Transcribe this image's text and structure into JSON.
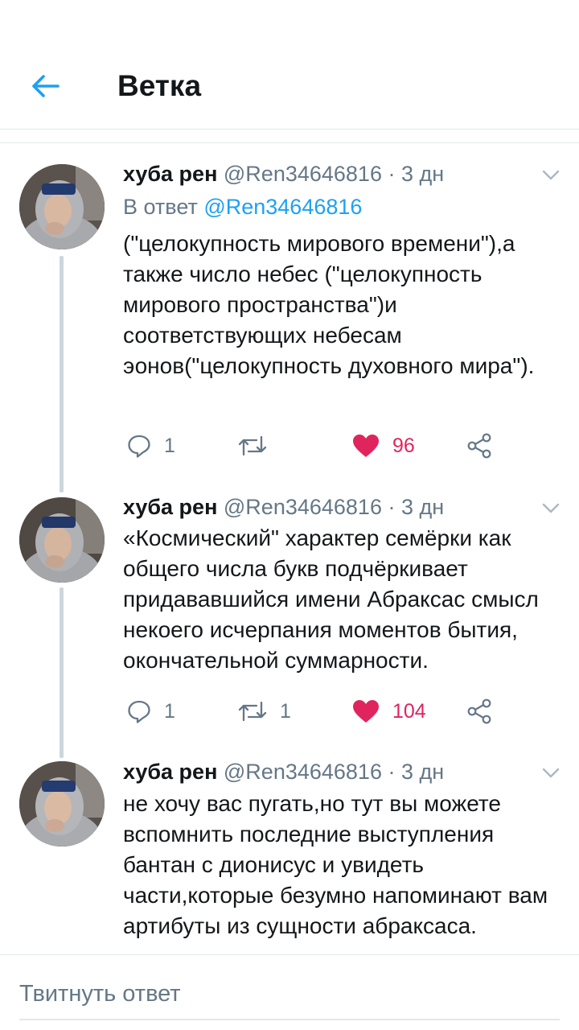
{
  "header": {
    "title": "Ветка",
    "back_icon": "arrow-left-icon",
    "accent_color": "#1da1f2"
  },
  "tweets": [
    {
      "author_name": "хуба рен",
      "handle": "@Ren34646816",
      "time": " · 3 дн",
      "reply_prefix": "В ответ ",
      "reply_mention": "@Ren34646816",
      "text": "(\"целокупность мирового времени\"),а также число небес (\"целокупность мирового пространства\")и соответствующих небесам эонов(\"целокупность духовного мира\").",
      "reply_count": "1",
      "retweet_count": "",
      "like_count": "96"
    },
    {
      "author_name": "хуба рен",
      "handle": "@Ren34646816",
      "time": " · 3 дн",
      "text": "«Космический\" характер семёрки как общего числа букв подчёркивает придававшийся имени Абраксас смысл некоего исчерпания моментов бытия, окончательной суммарности.",
      "reply_count": "1",
      "retweet_count": "1",
      "like_count": "104"
    },
    {
      "author_name": "хуба рен",
      "handle": "@Ren34646816",
      "time": " · 3 дн",
      "text": "не хочу вас пугать,но тут вы можете вспомнить последние выступления бантан с дионисус и увидеть части,которые безумно напоминают вам артибуты из сущности абраксаса."
    }
  ],
  "composer": {
    "placeholder": "Твитнуть ответ"
  },
  "colors": {
    "text": "#14171a",
    "secondary": "#657786",
    "like": "#e0245e",
    "link": "#1da1f2",
    "divider": "#e1e8ed"
  }
}
